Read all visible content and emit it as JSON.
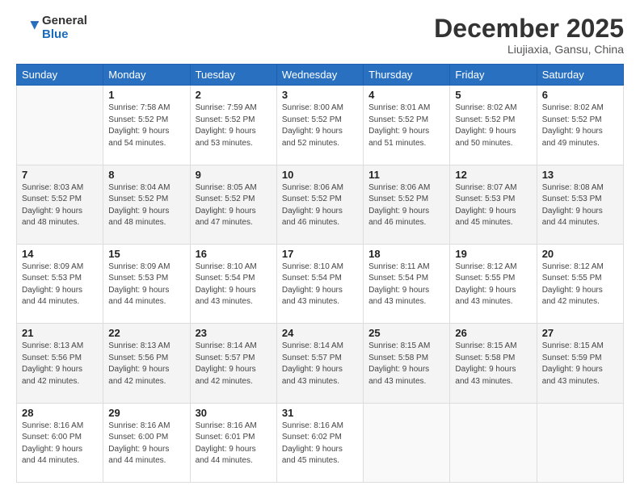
{
  "header": {
    "logo_general": "General",
    "logo_blue": "Blue",
    "month": "December 2025",
    "location": "Liujiaxia, Gansu, China"
  },
  "weekdays": [
    "Sunday",
    "Monday",
    "Tuesday",
    "Wednesday",
    "Thursday",
    "Friday",
    "Saturday"
  ],
  "weeks": [
    [
      {
        "day": "",
        "detail": ""
      },
      {
        "day": "1",
        "detail": "Sunrise: 7:58 AM\nSunset: 5:52 PM\nDaylight: 9 hours\nand 54 minutes."
      },
      {
        "day": "2",
        "detail": "Sunrise: 7:59 AM\nSunset: 5:52 PM\nDaylight: 9 hours\nand 53 minutes."
      },
      {
        "day": "3",
        "detail": "Sunrise: 8:00 AM\nSunset: 5:52 PM\nDaylight: 9 hours\nand 52 minutes."
      },
      {
        "day": "4",
        "detail": "Sunrise: 8:01 AM\nSunset: 5:52 PM\nDaylight: 9 hours\nand 51 minutes."
      },
      {
        "day": "5",
        "detail": "Sunrise: 8:02 AM\nSunset: 5:52 PM\nDaylight: 9 hours\nand 50 minutes."
      },
      {
        "day": "6",
        "detail": "Sunrise: 8:02 AM\nSunset: 5:52 PM\nDaylight: 9 hours\nand 49 minutes."
      }
    ],
    [
      {
        "day": "7",
        "detail": "Sunrise: 8:03 AM\nSunset: 5:52 PM\nDaylight: 9 hours\nand 48 minutes."
      },
      {
        "day": "8",
        "detail": "Sunrise: 8:04 AM\nSunset: 5:52 PM\nDaylight: 9 hours\nand 48 minutes."
      },
      {
        "day": "9",
        "detail": "Sunrise: 8:05 AM\nSunset: 5:52 PM\nDaylight: 9 hours\nand 47 minutes."
      },
      {
        "day": "10",
        "detail": "Sunrise: 8:06 AM\nSunset: 5:52 PM\nDaylight: 9 hours\nand 46 minutes."
      },
      {
        "day": "11",
        "detail": "Sunrise: 8:06 AM\nSunset: 5:52 PM\nDaylight: 9 hours\nand 46 minutes."
      },
      {
        "day": "12",
        "detail": "Sunrise: 8:07 AM\nSunset: 5:53 PM\nDaylight: 9 hours\nand 45 minutes."
      },
      {
        "day": "13",
        "detail": "Sunrise: 8:08 AM\nSunset: 5:53 PM\nDaylight: 9 hours\nand 44 minutes."
      }
    ],
    [
      {
        "day": "14",
        "detail": "Sunrise: 8:09 AM\nSunset: 5:53 PM\nDaylight: 9 hours\nand 44 minutes."
      },
      {
        "day": "15",
        "detail": "Sunrise: 8:09 AM\nSunset: 5:53 PM\nDaylight: 9 hours\nand 44 minutes."
      },
      {
        "day": "16",
        "detail": "Sunrise: 8:10 AM\nSunset: 5:54 PM\nDaylight: 9 hours\nand 43 minutes."
      },
      {
        "day": "17",
        "detail": "Sunrise: 8:10 AM\nSunset: 5:54 PM\nDaylight: 9 hours\nand 43 minutes."
      },
      {
        "day": "18",
        "detail": "Sunrise: 8:11 AM\nSunset: 5:54 PM\nDaylight: 9 hours\nand 43 minutes."
      },
      {
        "day": "19",
        "detail": "Sunrise: 8:12 AM\nSunset: 5:55 PM\nDaylight: 9 hours\nand 43 minutes."
      },
      {
        "day": "20",
        "detail": "Sunrise: 8:12 AM\nSunset: 5:55 PM\nDaylight: 9 hours\nand 42 minutes."
      }
    ],
    [
      {
        "day": "21",
        "detail": "Sunrise: 8:13 AM\nSunset: 5:56 PM\nDaylight: 9 hours\nand 42 minutes."
      },
      {
        "day": "22",
        "detail": "Sunrise: 8:13 AM\nSunset: 5:56 PM\nDaylight: 9 hours\nand 42 minutes."
      },
      {
        "day": "23",
        "detail": "Sunrise: 8:14 AM\nSunset: 5:57 PM\nDaylight: 9 hours\nand 42 minutes."
      },
      {
        "day": "24",
        "detail": "Sunrise: 8:14 AM\nSunset: 5:57 PM\nDaylight: 9 hours\nand 43 minutes."
      },
      {
        "day": "25",
        "detail": "Sunrise: 8:15 AM\nSunset: 5:58 PM\nDaylight: 9 hours\nand 43 minutes."
      },
      {
        "day": "26",
        "detail": "Sunrise: 8:15 AM\nSunset: 5:58 PM\nDaylight: 9 hours\nand 43 minutes."
      },
      {
        "day": "27",
        "detail": "Sunrise: 8:15 AM\nSunset: 5:59 PM\nDaylight: 9 hours\nand 43 minutes."
      }
    ],
    [
      {
        "day": "28",
        "detail": "Sunrise: 8:16 AM\nSunset: 6:00 PM\nDaylight: 9 hours\nand 44 minutes."
      },
      {
        "day": "29",
        "detail": "Sunrise: 8:16 AM\nSunset: 6:00 PM\nDaylight: 9 hours\nand 44 minutes."
      },
      {
        "day": "30",
        "detail": "Sunrise: 8:16 AM\nSunset: 6:01 PM\nDaylight: 9 hours\nand 44 minutes."
      },
      {
        "day": "31",
        "detail": "Sunrise: 8:16 AM\nSunset: 6:02 PM\nDaylight: 9 hours\nand 45 minutes."
      },
      {
        "day": "",
        "detail": ""
      },
      {
        "day": "",
        "detail": ""
      },
      {
        "day": "",
        "detail": ""
      }
    ]
  ]
}
